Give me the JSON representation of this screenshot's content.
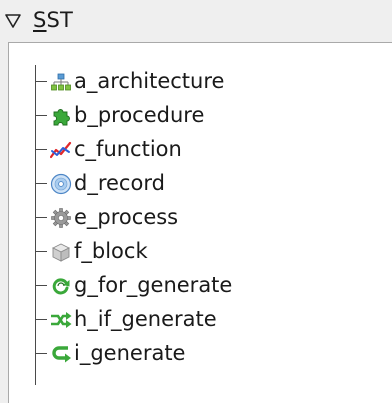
{
  "header": {
    "title_prefix": "",
    "title_mnemonic": "S",
    "title_rest": "ST",
    "expander_icon": "triangle-down-icon"
  },
  "tree": {
    "items": [
      {
        "label": "a_architecture",
        "icon": "hierarchy-icon"
      },
      {
        "label": "b_procedure",
        "icon": "puzzle-piece-icon"
      },
      {
        "label": "c_function",
        "icon": "function-graph-icon"
      },
      {
        "label": "d_record",
        "icon": "disc-icon"
      },
      {
        "label": "e_process",
        "icon": "gear-icon"
      },
      {
        "label": "f_block",
        "icon": "box-icon"
      },
      {
        "label": "g_for_generate",
        "icon": "loop-arrows-icon"
      },
      {
        "label": "h_if_generate",
        "icon": "branch-arrows-icon"
      },
      {
        "label": "i_generate",
        "icon": "return-arrow-icon"
      }
    ]
  }
}
